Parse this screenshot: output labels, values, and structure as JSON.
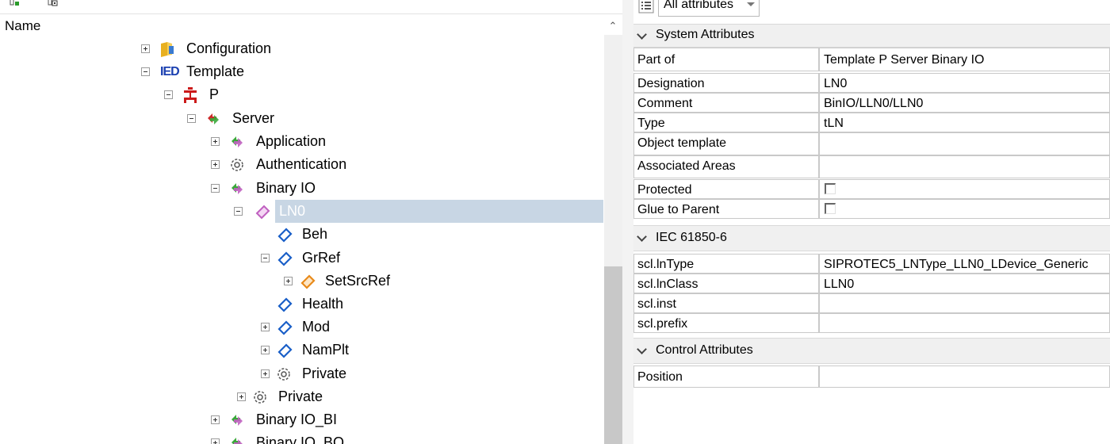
{
  "tree": {
    "header": "Name",
    "nodes": [
      {
        "label": "Configuration",
        "icon": "folder-icon",
        "expander": "plus"
      },
      {
        "label": "Template",
        "icon": "ied-icon",
        "icon_text": "IED",
        "expander": "minus"
      },
      {
        "label": "P",
        "icon": "physical-device-icon",
        "expander": "minus"
      },
      {
        "label": "Server",
        "icon": "server-icon",
        "expander": "minus"
      },
      {
        "label": "Application",
        "icon": "logical-device-icon",
        "expander": "plus"
      },
      {
        "label": "Authentication",
        "icon": "gear-icon",
        "expander": "plus"
      },
      {
        "label": "Binary IO",
        "icon": "logical-device-icon",
        "expander": "minus"
      },
      {
        "label": "LN0",
        "icon": "logical-node-icon",
        "expander": "minus",
        "selected": true
      },
      {
        "label": "Beh",
        "icon": "data-object-icon",
        "expander": "none"
      },
      {
        "label": "GrRef",
        "icon": "data-object-icon",
        "expander": "minus"
      },
      {
        "label": "SetSrcRef",
        "icon": "data-attribute-icon",
        "expander": "plus"
      },
      {
        "label": "Health",
        "icon": "data-object-icon",
        "expander": "none"
      },
      {
        "label": "Mod",
        "icon": "data-object-icon",
        "expander": "plus"
      },
      {
        "label": "NamPlt",
        "icon": "data-object-icon",
        "expander": "plus"
      },
      {
        "label": "Private",
        "icon": "gear-icon",
        "expander": "plus"
      },
      {
        "label": "Private",
        "icon": "gear-icon",
        "expander": "plus"
      },
      {
        "label": "Binary IO_BI",
        "icon": "logical-device-icon",
        "expander": "plus"
      },
      {
        "label": "Binary IO_BO",
        "icon": "logical-device-icon",
        "expander": "plus"
      }
    ]
  },
  "properties": {
    "filter_value": "All attributes",
    "sections": {
      "system": "System Attributes",
      "iec": "IEC 61850-6",
      "control": "Control Attributes"
    },
    "rows": {
      "part_of": {
        "key": "Part of",
        "value": "Template P Server Binary IO"
      },
      "designation": {
        "key": "Designation",
        "value": "LN0"
      },
      "comment": {
        "key": "Comment",
        "value": "BinIO/LLN0/LLN0"
      },
      "type": {
        "key": "Type",
        "value": "tLN"
      },
      "object_template": {
        "key": "Object template",
        "value": ""
      },
      "associated_areas": {
        "key": "Associated Areas",
        "value": ""
      },
      "protected": {
        "key": "Protected",
        "checked": false
      },
      "glue_to_parent": {
        "key": "Glue to Parent",
        "checked": false
      },
      "scl_lntype": {
        "key": "scl.lnType",
        "value": "SIPROTEC5_LNType_LLN0_LDevice_Generic"
      },
      "scl_lnclass": {
        "key": "scl.lnClass",
        "value": "LLN0"
      },
      "scl_inst": {
        "key": "scl.inst",
        "value": ""
      },
      "scl_prefix": {
        "key": "scl.prefix",
        "value": ""
      },
      "position": {
        "key": "Position",
        "value": ""
      }
    }
  },
  "colors": {
    "selection": "#c8d6e4",
    "section_bg": "#f0f0f0",
    "logical_node": "#c060c0",
    "data_object": "#1a5fc8",
    "data_attribute": "#e88a1a",
    "ied": "#1a3fb0",
    "physical_device": "#cc1a1a"
  }
}
